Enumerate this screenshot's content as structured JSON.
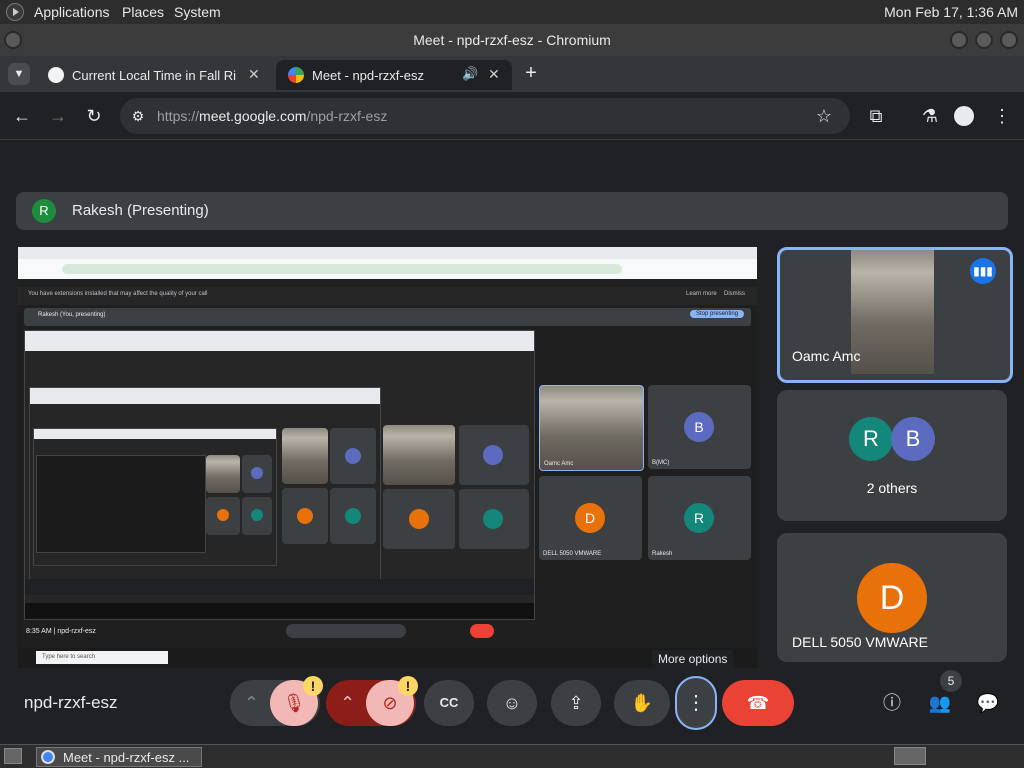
{
  "system_panel": {
    "menus": [
      "Applications",
      "Places",
      "System"
    ],
    "clock": "Mon Feb 17,  1:36 AM"
  },
  "window": {
    "title": "Meet - npd-rzxf-esz - Chromium"
  },
  "tabs": [
    {
      "label": "Current Local Time in Fall Ri",
      "active": false
    },
    {
      "label": "Meet - npd-rzxf-esz",
      "active": true
    }
  ],
  "toolbar": {
    "url_prefix": "https://",
    "url_host": "meet.google.com",
    "url_path": "/npd-rzxf-esz"
  },
  "meet": {
    "presenter_initial": "R",
    "presenting_label": "Rakesh (Presenting)",
    "meeting_code": "npd-rzxf-esz",
    "more_options_tooltip": "More options",
    "people_count": "5",
    "warning_glyph": "!",
    "tiles": [
      {
        "name": "Oamc Amc",
        "type": "video"
      },
      {
        "name": "2 others",
        "initials": [
          "R",
          "B"
        ],
        "colors": [
          "#12877a",
          "#5c6bc0"
        ]
      },
      {
        "name": "DELL 5050 VMWARE",
        "initial": "D",
        "color": "#e8710a"
      }
    ],
    "shared_screen": {
      "notice": "You have extensions installed that may affect the quality of your call",
      "notice_actions": [
        "Learn more",
        "Dismiss"
      ],
      "presenting_self": "Rakesh (You, presenting)",
      "stop_button": "Stop presenting",
      "meet_tiles": [
        {
          "name": "Oamc Amc",
          "initial": ""
        },
        {
          "name": "B(MC)",
          "initial": "B",
          "color": "#5c6bc0"
        },
        {
          "name": "DELL 5050 VMWARE",
          "initial": "D",
          "color": "#e8710a"
        },
        {
          "name": "Rakesh",
          "initial": "R",
          "color": "#12877a"
        }
      ],
      "time_code": "8:35 AM  |  npd-rzxf-esz",
      "search_placeholder": "Type here to search"
    }
  },
  "taskbar": {
    "item_label": "Meet - npd-rzxf-esz ..."
  },
  "colors": {
    "hangup": "#ea4335",
    "accent_blue": "#8ab4f8",
    "warning": "#fdd663"
  }
}
